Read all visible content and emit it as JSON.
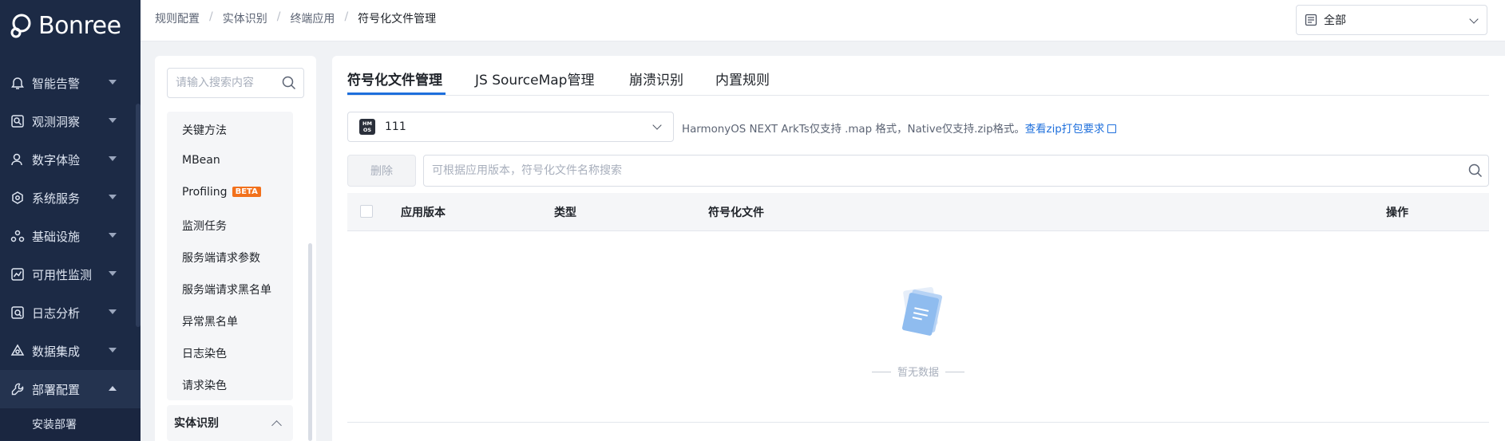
{
  "brand": {
    "name": "Bonree"
  },
  "sidebar": {
    "items": [
      {
        "label": "智能告警",
        "icon": "alert-icon"
      },
      {
        "label": "观测洞察",
        "icon": "insight-icon"
      },
      {
        "label": "数字体验",
        "icon": "user-experience-icon"
      },
      {
        "label": "系统服务",
        "icon": "system-service-icon"
      },
      {
        "label": "基础设施",
        "icon": "infrastructure-icon"
      },
      {
        "label": "可用性监测",
        "icon": "availability-icon"
      },
      {
        "label": "日志分析",
        "icon": "log-icon"
      },
      {
        "label": "数据集成",
        "icon": "data-integration-icon"
      },
      {
        "label": "部署配置",
        "icon": "wrench-icon"
      }
    ],
    "sub_items": [
      {
        "label": "安装部署"
      }
    ]
  },
  "breadcrumb": [
    "规则配置",
    "实体识别",
    "终端应用",
    "符号化文件管理"
  ],
  "scope_select": {
    "value": "全部"
  },
  "tree": {
    "search_placeholder": "请输入搜索内容",
    "items": [
      {
        "label": "关键方法"
      },
      {
        "label": "MBean"
      },
      {
        "label": "Profiling",
        "badge": "BETA"
      },
      {
        "label": "监测任务"
      },
      {
        "label": "服务端请求参数"
      },
      {
        "label": "服务端请求黑名单"
      },
      {
        "label": "异常黑名单"
      },
      {
        "label": "日志染色"
      },
      {
        "label": "请求染色"
      }
    ],
    "group": {
      "label": "实体识别"
    }
  },
  "tabs": [
    {
      "label": "符号化文件管理",
      "active": true
    },
    {
      "label": "JS SourceMap管理"
    },
    {
      "label": "崩溃识别"
    },
    {
      "label": "内置规则"
    }
  ],
  "app_select": {
    "value": "111",
    "icon_text": "HM OS"
  },
  "hint": {
    "text": "HarmonyOS NEXT ArkTs仅支持 .map 格式，Native仅支持.zip格式。",
    "link": "查看zip打包要求"
  },
  "toolbar": {
    "delete_label": "删除",
    "search_placeholder": "可根据应用版本，符号化文件名称搜索"
  },
  "table": {
    "columns": [
      "应用版本",
      "类型",
      "符号化文件",
      "操作"
    ],
    "rows": [],
    "empty_text": "暂无数据"
  },
  "colors": {
    "accent": "#1e6fdc",
    "sidebar_bg": "#1c2a45",
    "badge": "#f2711c"
  }
}
